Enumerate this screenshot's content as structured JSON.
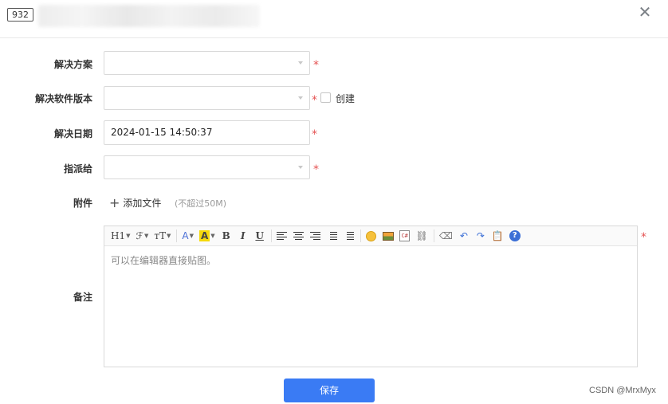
{
  "header": {
    "id_badge": "932",
    "close_glyph": "✕"
  },
  "form": {
    "solution": {
      "label": "解决方案",
      "value": "",
      "required_mark": "*"
    },
    "version": {
      "label": "解决软件版本",
      "value": "",
      "required_mark": "*",
      "create_label": "创建",
      "create_checked": false
    },
    "resolve_date": {
      "label": "解决日期",
      "value": "2024-01-15 14:50:37",
      "required_mark": "*"
    },
    "assign_to": {
      "label": "指派给",
      "value": "",
      "required_mark": "*"
    },
    "attachment": {
      "label": "附件",
      "add_label": "添加文件",
      "limit_hint": "(不超过50M)"
    },
    "notes": {
      "label": "备注",
      "required_mark": "*",
      "placeholder": "可以在编辑器直接贴图。",
      "toolbar": {
        "heading": "H1",
        "font_family": "ℱ",
        "font_size": "тT",
        "font_color": "A",
        "highlight": "A",
        "bold": "B",
        "italic": "I",
        "underline": "U",
        "code_label": "C#",
        "help": "?"
      }
    }
  },
  "actions": {
    "save_label": "保存"
  },
  "watermark": "CSDN @MrxMyx",
  "colors": {
    "primary": "#3a7bf4",
    "required": "#e55353",
    "highlight": "#f5d90a"
  }
}
